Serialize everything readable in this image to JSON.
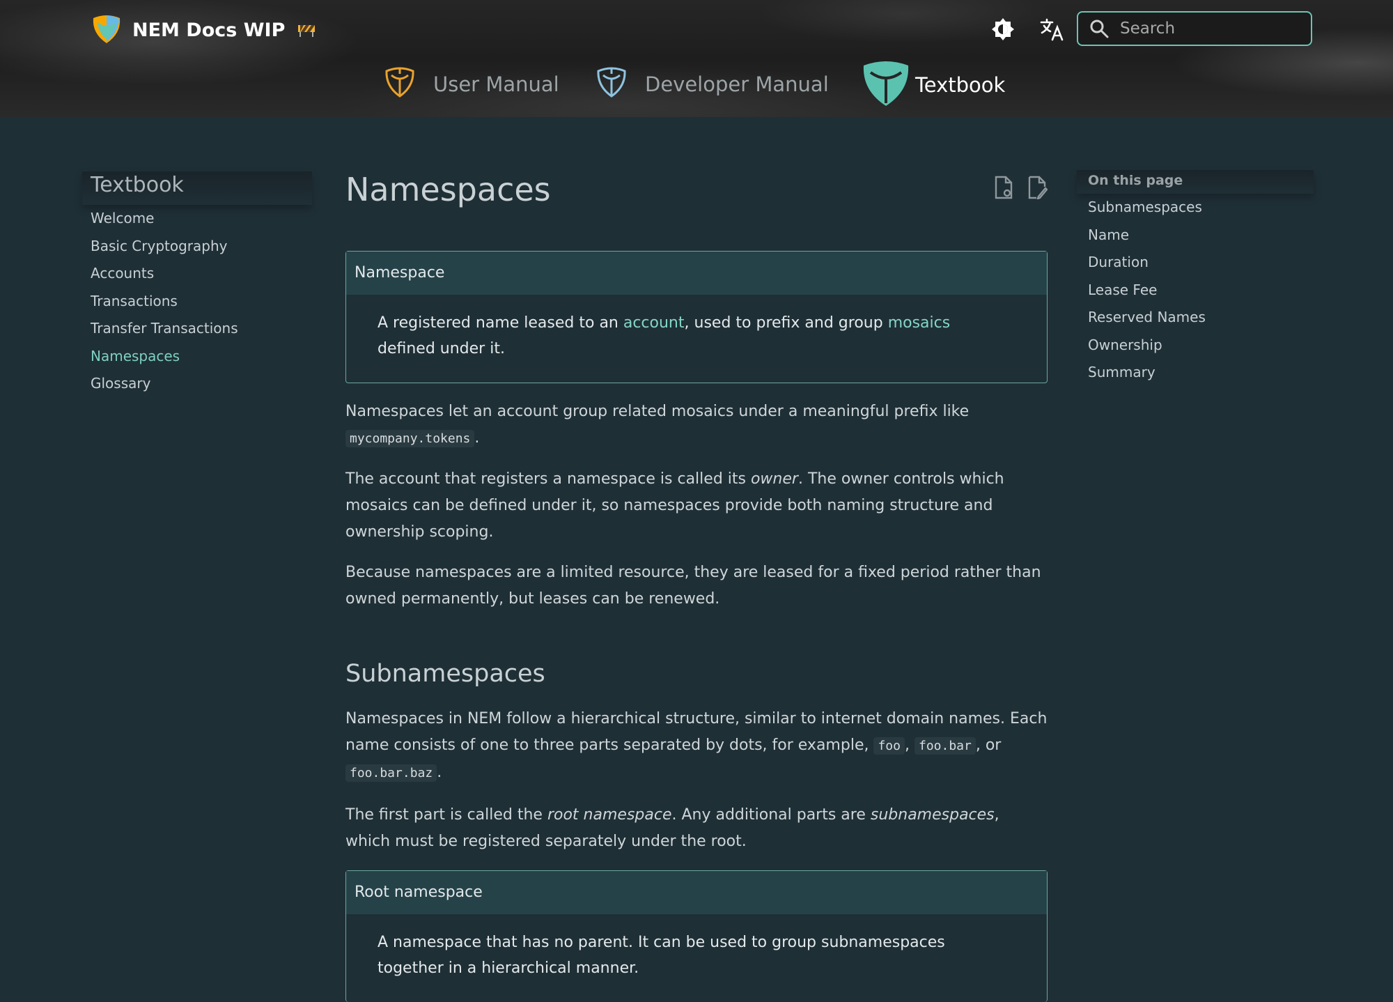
{
  "header": {
    "brand_title": "NEM Docs WIP",
    "search_placeholder": "Search",
    "nav": [
      {
        "label": "User Manual",
        "icon": "nem-logo-orange-icon"
      },
      {
        "label": "Developer Manual",
        "icon": "nem-logo-blue-icon"
      },
      {
        "label": "Textbook",
        "icon": "nem-logo-teal-icon",
        "active": true
      }
    ]
  },
  "sidebar": {
    "title": "Textbook",
    "items": [
      {
        "label": "Welcome"
      },
      {
        "label": "Basic Cryptography"
      },
      {
        "label": "Accounts"
      },
      {
        "label": "Transactions"
      },
      {
        "label": "Transfer Transactions"
      },
      {
        "label": "Namespaces",
        "active": true
      },
      {
        "label": "Glossary"
      }
    ]
  },
  "main": {
    "title": "Namespaces",
    "definition1": {
      "head": "Namespace",
      "text1": "A registered name leased to an ",
      "link1": "account",
      "text2": ", used to prefix and group ",
      "link2": "mosaics",
      "text3": " defined under it."
    },
    "p1": {
      "text": "Namespaces let an account group related mosaics under a meaningful prefix like ",
      "code": "mycompany.tokens",
      "end": "."
    },
    "p2": {
      "text1": "The account that registers a namespace is called its ",
      "em": "owner",
      "text2": ". The owner controls which mosaics can be defined under it, so namespaces provide both naming structure and ownership scoping."
    },
    "p3": "Because namespaces are a limited resource, they are leased for a fixed period rather than owned permanently, but leases can be renewed.",
    "h2_sub": "Subnamespaces",
    "p4": {
      "text1": "Namespaces in NEM follow a hierarchical structure, similar to internet domain names. Each name consists of one to three parts separated by dots, for example, ",
      "code1": "foo",
      "sep1": ", ",
      "code2": "foo.bar",
      "sep2": ", or ",
      "code3": "foo.bar.baz",
      "end": "."
    },
    "p5": {
      "text1": "The first part is called the ",
      "em1": "root namespace",
      "text2": ". Any additional parts are ",
      "em2": "subnamespaces",
      "text3": ", which must be registered separately under the root."
    },
    "definition2": {
      "head": "Root namespace",
      "text": "A namespace that has no parent. It can be used to group subnamespaces together in a hierarchical manner."
    }
  },
  "toc": {
    "title": "On this page",
    "items": [
      "Subnamespaces",
      "Name",
      "Duration",
      "Lease Fee",
      "Reserved Names",
      "Ownership",
      "Summary"
    ]
  },
  "colors": {
    "accent": "#7fd0c1",
    "background": "#1f2f36",
    "header": "#222222",
    "border": "#6aa8a0"
  }
}
